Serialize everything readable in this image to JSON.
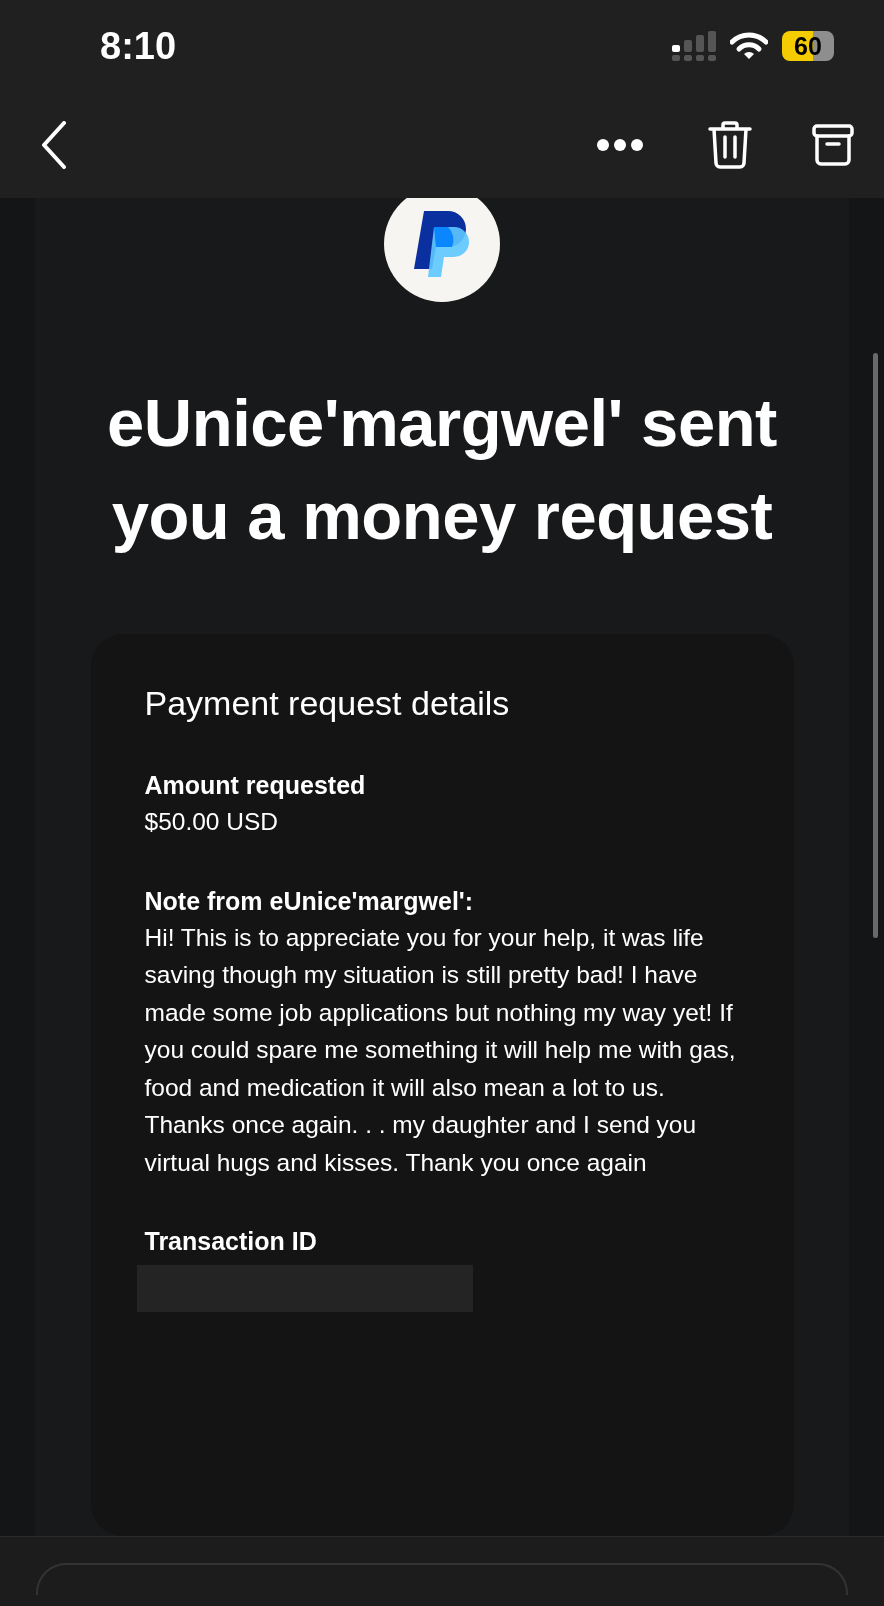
{
  "status_bar": {
    "time": "8:10",
    "battery": "60"
  },
  "nav": {
    "buttons": [
      {
        "kind": "back"
      },
      {
        "kind": "more"
      },
      {
        "kind": "trash"
      },
      {
        "kind": "archive"
      }
    ]
  },
  "email": {
    "title": "eUnice'margwel' sent you a money request",
    "card": {
      "heading": "Payment request details",
      "fields": [
        {
          "label": "Amount requested",
          "value": "$50.00 USD"
        },
        {
          "label": "Note from eUnice'margwel':",
          "value": "Hi! This is to appreciate you for your help, it was life saving though my situation is still pretty bad! I have made some job applications but nothing my way yet! If you could spare me something it will help me with gas, food and medication it will also mean a lot to us. Thanks once again. . . my daughter and I send you virtual hugs and kisses. Thank you once again"
        },
        {
          "label": "Transaction ID",
          "redacted": true
        }
      ]
    }
  }
}
